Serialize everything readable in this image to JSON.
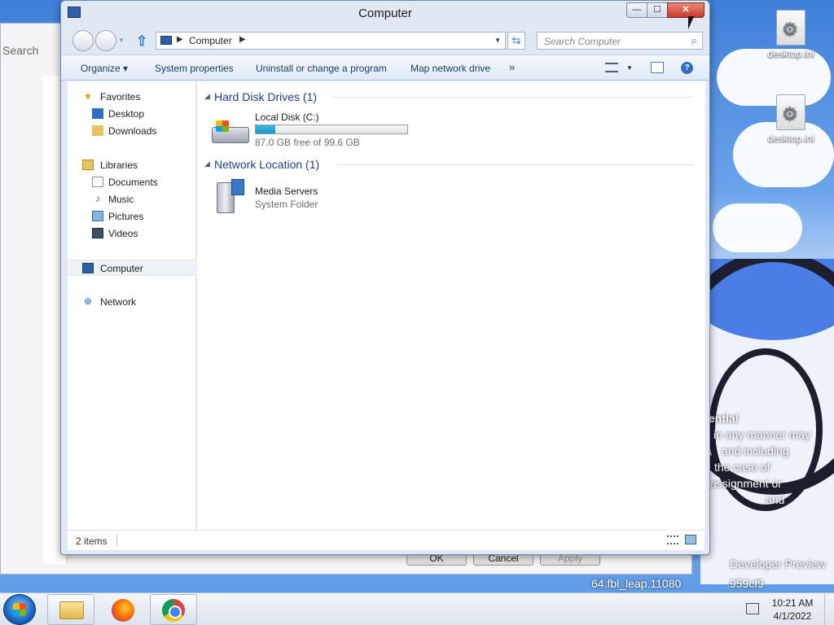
{
  "window": {
    "title": "Computer",
    "caption": {
      "minimize": "—",
      "maximize": "☐",
      "close": "✕"
    }
  },
  "address": {
    "location": "Computer"
  },
  "search": {
    "placeholder": "Search Computer"
  },
  "toolbar": {
    "organize": "Organize ▾",
    "system_properties": "System properties",
    "uninstall": "Uninstall or change a program",
    "map_drive": "Map network drive",
    "more": "»",
    "help": "?"
  },
  "nav": {
    "favorites": "Favorites",
    "desktop": "Desktop",
    "downloads": "Downloads",
    "libraries": "Libraries",
    "documents": "Documents",
    "music": "Music",
    "pictures": "Pictures",
    "videos": "Videos",
    "computer": "Computer",
    "network": "Network"
  },
  "groups": {
    "hdd_title": "Hard Disk Drives (1)",
    "net_title": "Network Location (1)"
  },
  "drive": {
    "name": "Local Disk (C:)",
    "free": "87.0 GB free of 99.6 GB",
    "used_fraction": 0.127
  },
  "network_item": {
    "name": "Media Servers",
    "type": "System Folder"
  },
  "status": {
    "items": "2 items"
  },
  "background_window": {
    "search_label": "Search",
    "ok": "OK",
    "cancel": "Cancel",
    "apply": "Apply"
  },
  "desktop": {
    "icon1": "desktop.ini",
    "icon2": "desktop.ini",
    "wallpaper_text": [
      "ential",
      "in any manner may",
      "and including",
      "the case of",
      "assignment or",
      "and",
      "Developer Preview",
      "64.fbl_leap.11080",
      ".959cf9"
    ]
  },
  "taskbar": {
    "time": "10:21 AM",
    "date": "4/1/2022"
  },
  "colors": {
    "accent": "#1e3f85",
    "close": "#c8392a",
    "usage": "#1896c4"
  }
}
